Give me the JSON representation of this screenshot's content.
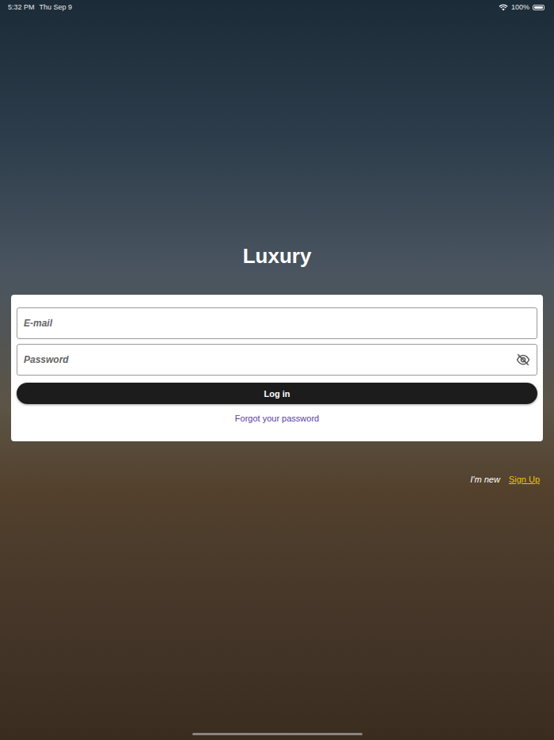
{
  "status_bar": {
    "time": "5:32 PM",
    "date": "Thu Sep 9",
    "battery": "100%",
    "battery_level": 1
  },
  "title": "Luxury",
  "fields": [
    {
      "placeholder": "E-mail",
      "kind": "text",
      "password_visible": false
    },
    {
      "placeholder": "Password",
      "kind": "password",
      "password_visible": false
    }
  ],
  "login_button": "Log in",
  "forgot_link": "Forgot your password",
  "signup": {
    "prompt": "I'm new",
    "link": "Sign Up"
  }
}
